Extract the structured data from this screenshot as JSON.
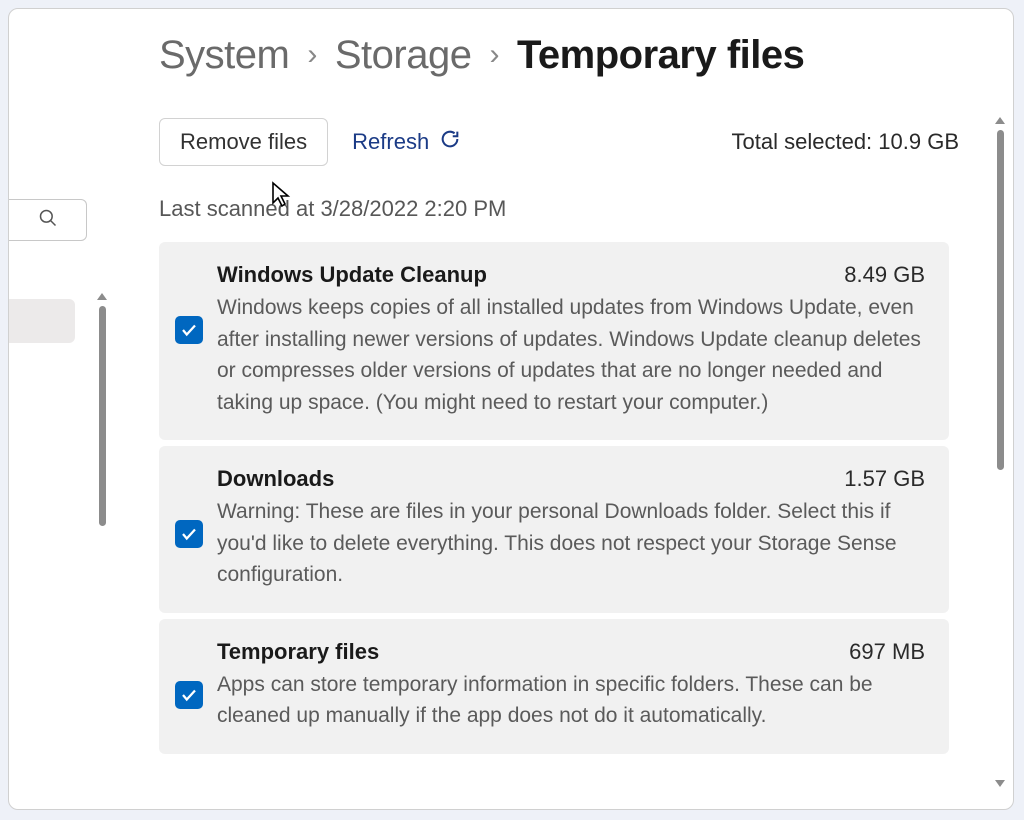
{
  "breadcrumb": {
    "system": "System",
    "storage": "Storage",
    "current": "Temporary files"
  },
  "actions": {
    "remove_label": "Remove files",
    "refresh_label": "Refresh"
  },
  "total_selected_label": "Total selected: 10.9 GB",
  "last_scanned_label": "Last scanned at 3/28/2022 2:20 PM",
  "items": [
    {
      "title": "Windows Update Cleanup",
      "size": "8.49 GB",
      "description": "Windows keeps copies of all installed updates from Windows Update, even after installing newer versions of updates. Windows Update cleanup deletes or compresses older versions of updates that are no longer needed and taking up space. (You might need to restart your computer.)",
      "checked": true
    },
    {
      "title": "Downloads",
      "size": "1.57 GB",
      "description": "Warning: These are files in your personal Downloads folder. Select this if you'd like to delete everything. This does not respect your Storage Sense configuration.",
      "checked": true
    },
    {
      "title": "Temporary files",
      "size": "697 MB",
      "description": "Apps can store temporary information in specific folders. These can be cleaned up manually if the app does not do it automatically.",
      "checked": true
    }
  ],
  "colors": {
    "accent": "#0067c0",
    "link": "#1b3b86"
  }
}
